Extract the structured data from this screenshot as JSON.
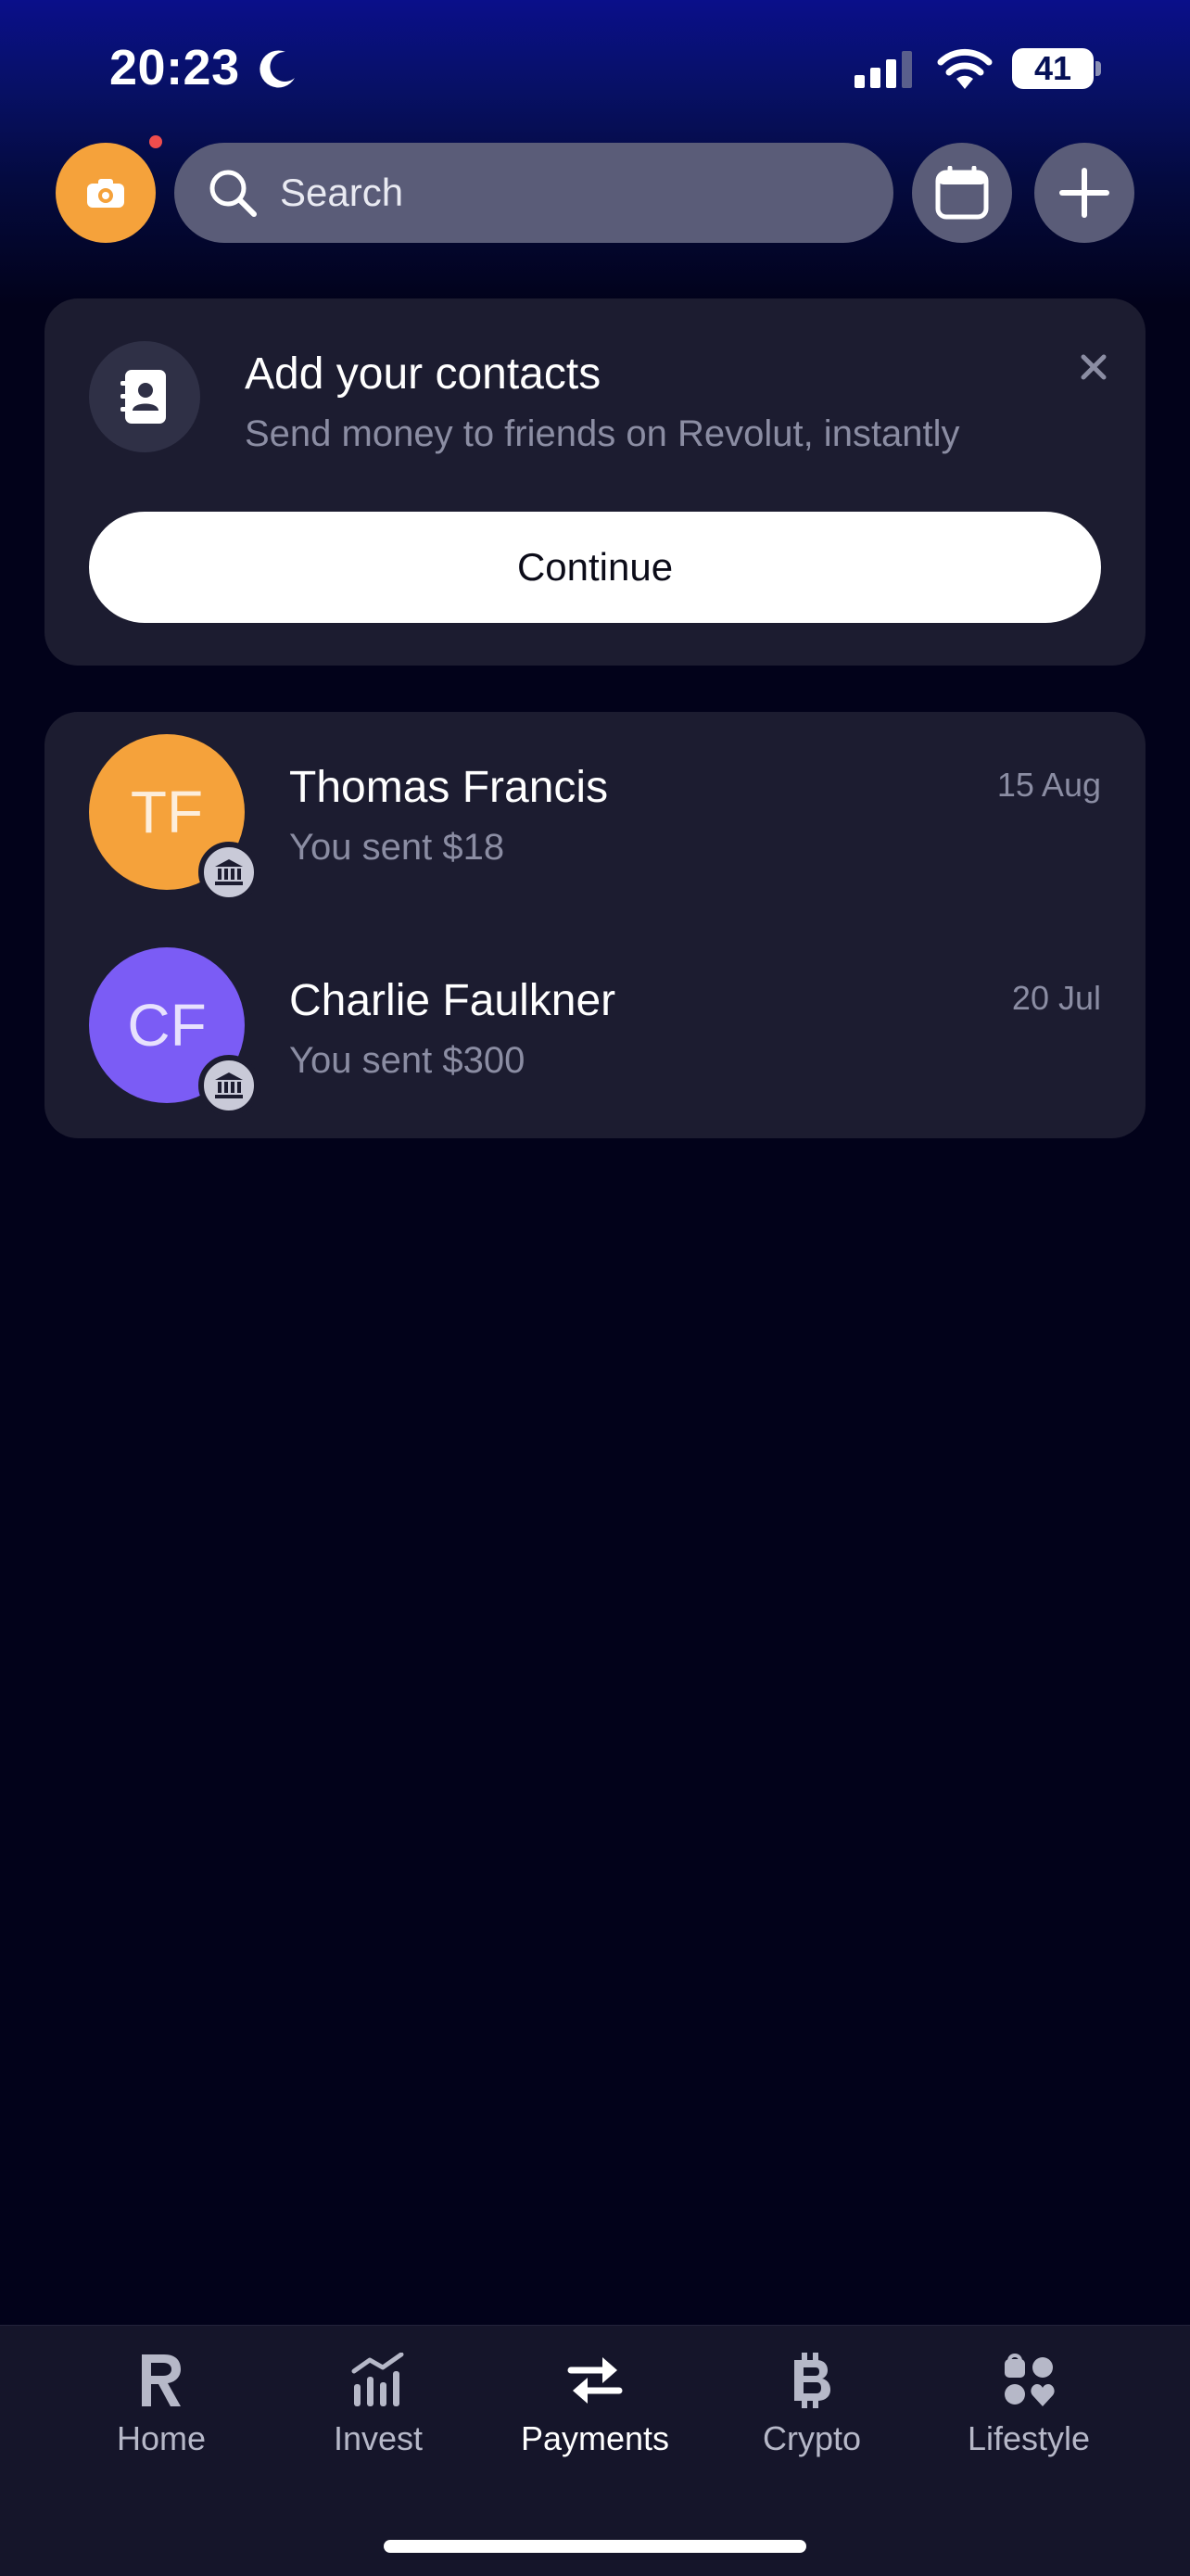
{
  "status_bar": {
    "time": "20:23",
    "battery": "41"
  },
  "search": {
    "placeholder": "Search"
  },
  "contacts_card": {
    "title": "Add your contacts",
    "subtitle": "Send money to friends on Revolut, instantly",
    "continue_label": "Continue"
  },
  "transfers": [
    {
      "initials": "TF",
      "name": "Thomas Francis",
      "subtitle": "You sent $18",
      "date": "15 Aug",
      "avatar_color": "#f5a23b"
    },
    {
      "initials": "CF",
      "name": "Charlie Faulkner",
      "subtitle": "You sent $300",
      "date": "20 Jul",
      "avatar_color": "#7b5cf5"
    }
  ],
  "nav": [
    {
      "label": "Home",
      "icon": "revolut-r-icon"
    },
    {
      "label": "Invest",
      "icon": "chart-icon"
    },
    {
      "label": "Payments",
      "icon": "transfer-arrows-icon",
      "active": true
    },
    {
      "label": "Crypto",
      "icon": "bitcoin-icon"
    },
    {
      "label": "Lifestyle",
      "icon": "lifestyle-icon"
    }
  ],
  "colors": {
    "accent": "#f5a23b",
    "background": "#02021a",
    "card": "#1c1c30",
    "notification": "#ef4d4d"
  }
}
